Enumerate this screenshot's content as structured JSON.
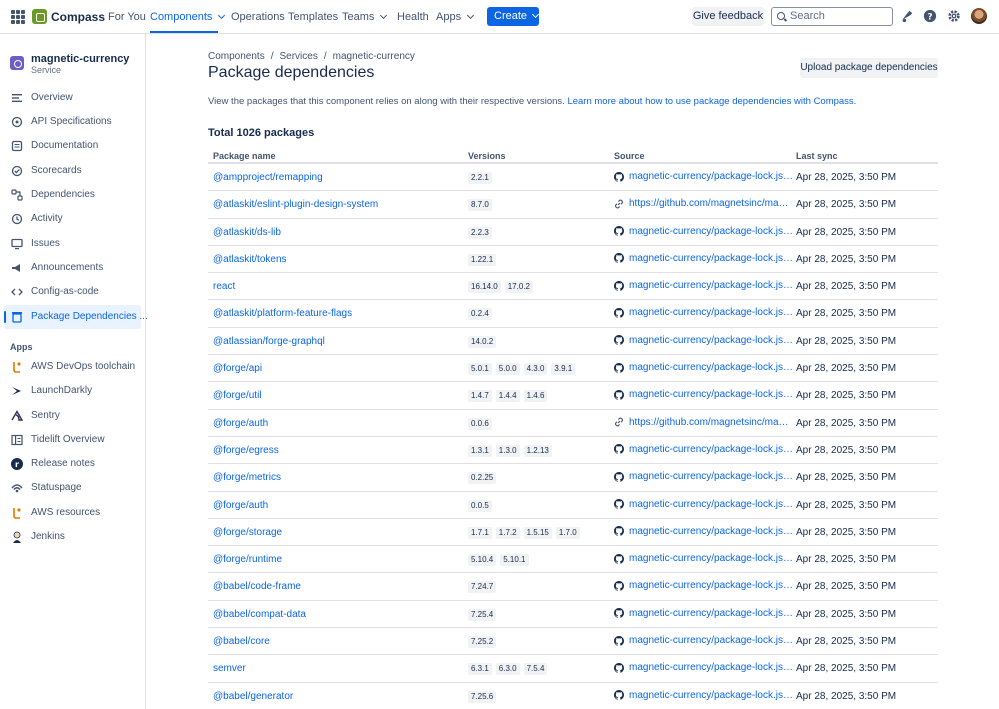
{
  "topbar": {
    "logo_text": "Compass",
    "nav": [
      {
        "label": "For You"
      },
      {
        "label": "Components"
      },
      {
        "label": "Operations"
      },
      {
        "label": "Templates"
      },
      {
        "label": "Teams"
      },
      {
        "label": "Health"
      },
      {
        "label": "Apps"
      }
    ],
    "create_label": "Create",
    "feedback_label": "Give feedback",
    "search_placeholder": "Search",
    "accent_color": "#0c66e4"
  },
  "sidebar": {
    "service_name": "magnetic-currency",
    "service_type": "Service",
    "items": [
      {
        "label": "Overview",
        "icon": "overview-icon"
      },
      {
        "label": "API Specifications",
        "icon": "api-icon"
      },
      {
        "label": "Documentation",
        "icon": "document-icon"
      },
      {
        "label": "Scorecards",
        "icon": "scorecard-icon"
      },
      {
        "label": "Dependencies",
        "icon": "dependencies-icon"
      },
      {
        "label": "Activity",
        "icon": "activity-icon"
      },
      {
        "label": "Issues",
        "icon": "issues-icon"
      },
      {
        "label": "Announcements",
        "icon": "megaphone-icon"
      },
      {
        "label": "Config-as-code",
        "icon": "code-icon"
      },
      {
        "label": "Package Dependencies ...",
        "icon": "package-icon",
        "selected": true
      }
    ],
    "apps_heading": "Apps",
    "apps": [
      {
        "label": "AWS DevOps toolchain",
        "icon": "aws-devops-icon"
      },
      {
        "label": "LaunchDarkly",
        "icon": "launchdarkly-icon"
      },
      {
        "label": "Sentry",
        "icon": "sentry-icon"
      },
      {
        "label": "Tidelift Overview",
        "icon": "tidelift-icon"
      },
      {
        "label": "Release notes",
        "icon": "release-notes-icon"
      },
      {
        "label": "Statuspage",
        "icon": "statuspage-icon"
      },
      {
        "label": "AWS resources",
        "icon": "aws-resources-icon"
      },
      {
        "label": "Jenkins",
        "icon": "jenkins-icon"
      }
    ]
  },
  "main": {
    "breadcrumb": [
      "Components",
      "Services",
      "magnetic-currency"
    ],
    "title": "Package dependencies",
    "upload_label": "Upload package dependencies",
    "description": "View the packages that this component relies on along with their respective versions.",
    "description_link": "Learn more about how to use package dependencies with Compass.",
    "total": "Total 1026 packages",
    "columns": [
      "Package name",
      "Versions",
      "Source",
      "Last sync"
    ],
    "rows": [
      {
        "name": "@ampproject/remapping",
        "versions": [
          "2.2.1"
        ],
        "source_type": "github",
        "source": "magnetic-currency/package-lock.json (main)",
        "sync": "Apr 28, 2025, 3:50 PM"
      },
      {
        "name": "@atlaskit/eslint-plugin-design-system",
        "versions": [
          "8.7.0"
        ],
        "source_type": "link",
        "source": "https://github.com/magnetsinc/magnetic-currency",
        "sync": "Apr 28, 2025, 3:50 PM"
      },
      {
        "name": "@atlaskit/ds-lib",
        "versions": [
          "2.2.3"
        ],
        "source_type": "github",
        "source": "magnetic-currency/package-lock.json (main)",
        "sync": "Apr 28, 2025, 3:50 PM"
      },
      {
        "name": "@atlaskit/tokens",
        "versions": [
          "1.22.1"
        ],
        "source_type": "github",
        "source": "magnetic-currency/package-lock.json (main)",
        "sync": "Apr 28, 2025, 3:50 PM"
      },
      {
        "name": "react",
        "versions": [
          "16.14.0",
          "17.0.2"
        ],
        "source_type": "github",
        "source": "magnetic-currency/package-lock.json (main)",
        "sync": "Apr 28, 2025, 3:50 PM"
      },
      {
        "name": "@atlaskit/platform-feature-flags",
        "versions": [
          "0.2.4"
        ],
        "source_type": "github",
        "source": "magnetic-currency/package-lock.json (main)",
        "sync": "Apr 28, 2025, 3:50 PM"
      },
      {
        "name": "@atlassian/forge-graphql",
        "versions": [
          "14.0.2"
        ],
        "source_type": "github",
        "source": "magnetic-currency/package-lock.json (main)",
        "sync": "Apr 28, 2025, 3:50 PM"
      },
      {
        "name": "@forge/api",
        "versions": [
          "5.0.1",
          "5.0.0",
          "4.3.0",
          "3.9.1"
        ],
        "source_type": "github",
        "source": "magnetic-currency/package-lock.json (main)",
        "sync": "Apr 28, 2025, 3:50 PM"
      },
      {
        "name": "@forge/util",
        "versions": [
          "1.4.7",
          "1.4.4",
          "1.4.6"
        ],
        "source_type": "github",
        "source": "magnetic-currency/package-lock.json (main)",
        "sync": "Apr 28, 2025, 3:50 PM"
      },
      {
        "name": "@forge/auth",
        "versions": [
          "0.0.6"
        ],
        "source_type": "link",
        "source": "https://github.com/magnetsinc/magnetic-currency",
        "sync": "Apr 28, 2025, 3:50 PM"
      },
      {
        "name": "@forge/egress",
        "versions": [
          "1.3.1",
          "1.3.0",
          "1.2.13"
        ],
        "source_type": "github",
        "source": "magnetic-currency/package-lock.json (main)",
        "sync": "Apr 28, 2025, 3:50 PM"
      },
      {
        "name": "@forge/metrics",
        "versions": [
          "0.2.25"
        ],
        "source_type": "github",
        "source": "magnetic-currency/package-lock.json (main)",
        "sync": "Apr 28, 2025, 3:50 PM"
      },
      {
        "name": "@forge/auth",
        "versions": [
          "0.0.5"
        ],
        "source_type": "github",
        "source": "magnetic-currency/package-lock.json (main)",
        "sync": "Apr 28, 2025, 3:50 PM"
      },
      {
        "name": "@forge/storage",
        "versions": [
          "1.7.1",
          "1.7.2",
          "1.5.15",
          "1.7.0"
        ],
        "source_type": "github",
        "source": "magnetic-currency/package-lock.json (main)",
        "sync": "Apr 28, 2025, 3:50 PM"
      },
      {
        "name": "@forge/runtime",
        "versions": [
          "5.10.4",
          "5.10.1"
        ],
        "source_type": "github",
        "source": "magnetic-currency/package-lock.json (main)",
        "sync": "Apr 28, 2025, 3:50 PM"
      },
      {
        "name": "@babel/code-frame",
        "versions": [
          "7.24.7"
        ],
        "source_type": "github",
        "source": "magnetic-currency/package-lock.json (main)",
        "sync": "Apr 28, 2025, 3:50 PM"
      },
      {
        "name": "@babel/compat-data",
        "versions": [
          "7.25.4"
        ],
        "source_type": "github",
        "source": "magnetic-currency/package-lock.json (main)",
        "sync": "Apr 28, 2025, 3:50 PM"
      },
      {
        "name": "@babel/core",
        "versions": [
          "7.25.2"
        ],
        "source_type": "github",
        "source": "magnetic-currency/package-lock.json (main)",
        "sync": "Apr 28, 2025, 3:50 PM"
      },
      {
        "name": "semver",
        "versions": [
          "6.3.1",
          "6.3.0",
          "7.5.4"
        ],
        "source_type": "github",
        "source": "magnetic-currency/package-lock.json (main)",
        "sync": "Apr 28, 2025, 3:50 PM"
      },
      {
        "name": "@babel/generator",
        "versions": [
          "7.25.6"
        ],
        "source_type": "github",
        "source": "magnetic-currency/package-lock.json (main)",
        "sync": "Apr 28, 2025, 3:50 PM"
      }
    ]
  }
}
